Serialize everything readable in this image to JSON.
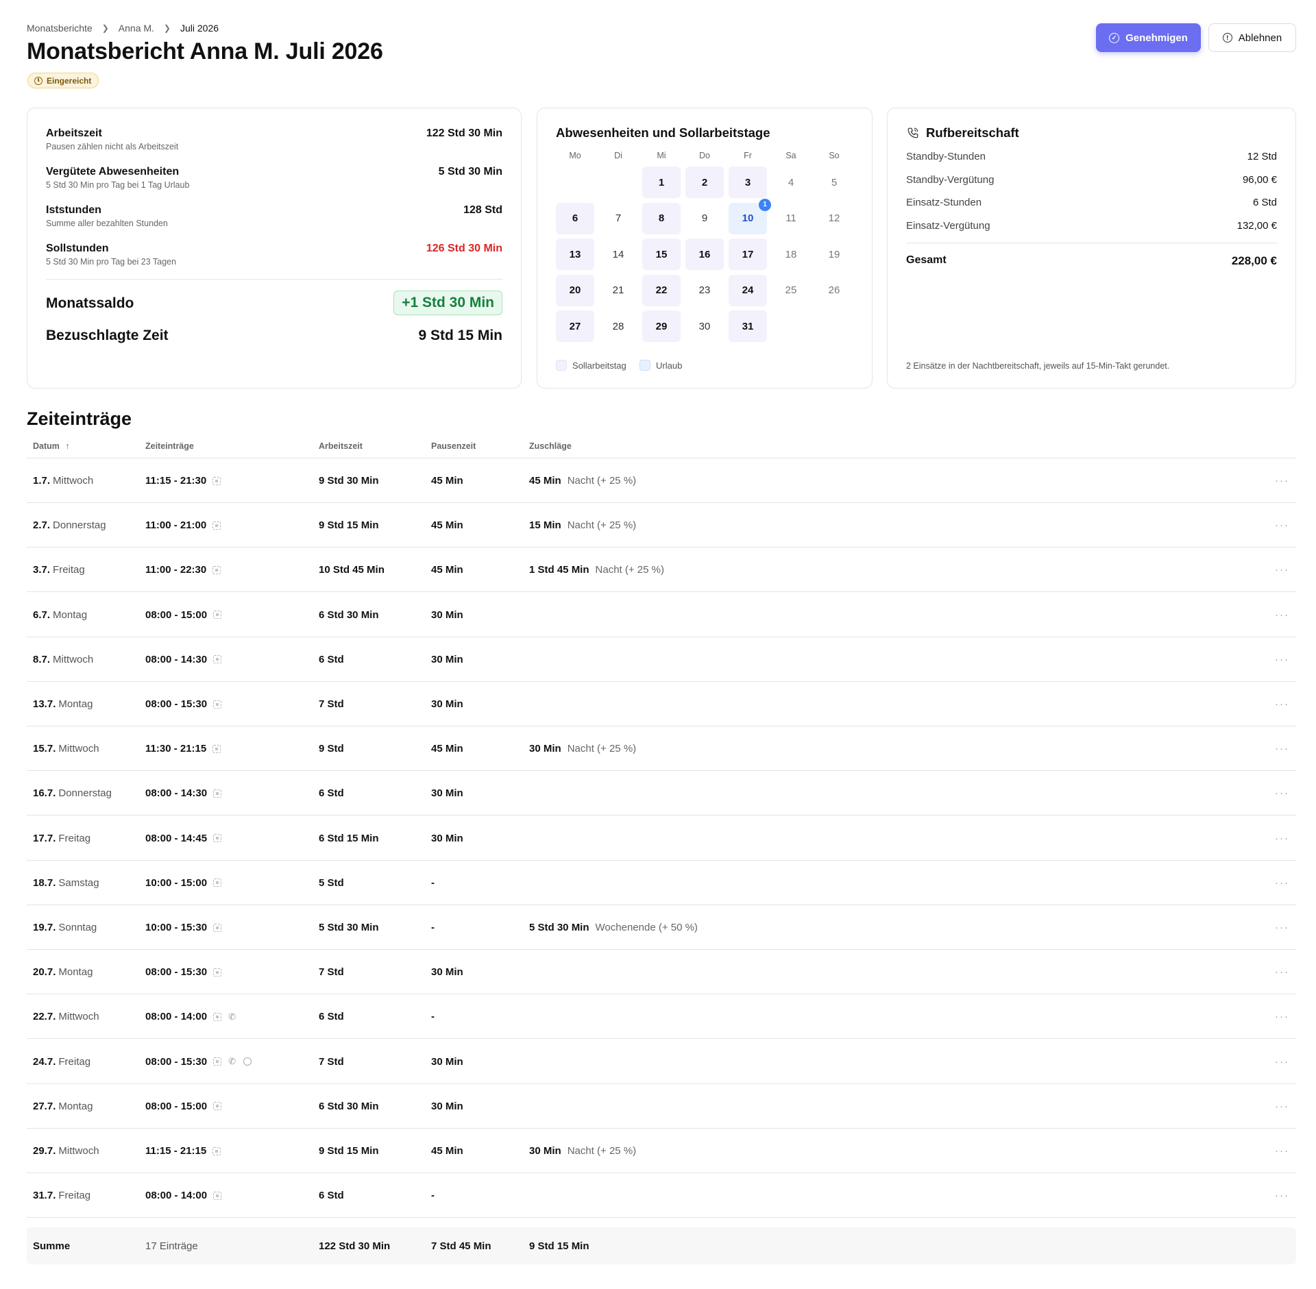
{
  "breadcrumb": [
    "Monatsberichte",
    "Anna M.",
    "Juli 2026"
  ],
  "page_title": "Monatsbericht Anna M. Juli 2026",
  "status": "Eingereicht",
  "actions": {
    "approve": "Genehmigen",
    "reject": "Ablehnen"
  },
  "colors": {
    "accent": "#6b6ef0",
    "negative": "#dc2626",
    "positive": "#15803d",
    "status_bg": "#fdf3dc"
  },
  "summary": {
    "arbeitszeit": {
      "label": "Arbeitszeit",
      "sub": "Pausen zählen nicht als Arbeitszeit",
      "value": "122 Std 30 Min"
    },
    "abwesenheiten": {
      "label": "Vergütete Abwesenheiten",
      "sub": "5 Std 30 Min pro Tag bei 1 Tag Urlaub",
      "value": "5 Std 30 Min"
    },
    "iststunden": {
      "label": "Iststunden",
      "sub": "Summe aller bezahlten Stunden",
      "value": "128 Std"
    },
    "sollstunden": {
      "label": "Sollstunden",
      "sub": "5 Std 30 Min pro Tag bei 23 Tagen",
      "value": "126 Std 30 Min"
    },
    "saldo": {
      "label": "Monatssaldo",
      "value": "+1 Std 30 Min"
    },
    "zuschlag": {
      "label": "Bezuschlagte Zeit",
      "value": "9 Std 15 Min"
    }
  },
  "calendar": {
    "title": "Abwesenheiten und Sollarbeitstage",
    "weekdays": [
      "Mo",
      "Di",
      "Mi",
      "Do",
      "Fr",
      "Sa",
      "So"
    ],
    "weeks": [
      [
        null,
        null,
        {
          "d": "1",
          "t": "w"
        },
        {
          "d": "2",
          "t": "w"
        },
        {
          "d": "3",
          "t": "w"
        },
        {
          "d": "4",
          "t": "wk"
        },
        {
          "d": "5",
          "t": "wk"
        }
      ],
      [
        {
          "d": "6",
          "t": "w"
        },
        {
          "d": "7",
          "t": "p"
        },
        {
          "d": "8",
          "t": "w"
        },
        {
          "d": "9",
          "t": "p"
        },
        {
          "d": "10",
          "t": "u",
          "badge": "1"
        },
        {
          "d": "11",
          "t": "wk"
        },
        {
          "d": "12",
          "t": "wk"
        }
      ],
      [
        {
          "d": "13",
          "t": "w"
        },
        {
          "d": "14",
          "t": "p"
        },
        {
          "d": "15",
          "t": "w"
        },
        {
          "d": "16",
          "t": "w"
        },
        {
          "d": "17",
          "t": "w"
        },
        {
          "d": "18",
          "t": "wk"
        },
        {
          "d": "19",
          "t": "wk"
        }
      ],
      [
        {
          "d": "20",
          "t": "w"
        },
        {
          "d": "21",
          "t": "p"
        },
        {
          "d": "22",
          "t": "w"
        },
        {
          "d": "23",
          "t": "p"
        },
        {
          "d": "24",
          "t": "w"
        },
        {
          "d": "25",
          "t": "wk"
        },
        {
          "d": "26",
          "t": "wk"
        }
      ],
      [
        {
          "d": "27",
          "t": "w"
        },
        {
          "d": "28",
          "t": "p"
        },
        {
          "d": "29",
          "t": "w"
        },
        {
          "d": "30",
          "t": "p"
        },
        {
          "d": "31",
          "t": "w"
        },
        null,
        null
      ]
    ],
    "legend": [
      "Sollarbeitstag",
      "Urlaub"
    ]
  },
  "standby": {
    "title": "Rufbereitschaft",
    "rows": [
      {
        "label": "Standby-Stunden",
        "value": "12 Std"
      },
      {
        "label": "Standby-Vergütung",
        "value": "96,00 €"
      },
      {
        "label": "Einsatz-Stunden",
        "value": "6 Std"
      },
      {
        "label": "Einsatz-Vergütung",
        "value": "132,00 €"
      }
    ],
    "total_label": "Gesamt",
    "total_value": "228,00 €",
    "note": "2 Einsätze in der Nachtbereitschaft, jeweils auf 15-Min-Takt gerundet."
  },
  "table": {
    "title": "Zeiteinträge",
    "columns": [
      "Datum",
      "Zeiteinträge",
      "Arbeitszeit",
      "Pausenzeit",
      "Zuschläge"
    ],
    "sort_indicator": "↑",
    "more_label": "···",
    "rows": [
      {
        "date": "1.7.",
        "day": "Mittwoch",
        "time": "11:15 - 21:30",
        "icons": [
          "qr"
        ],
        "work": "9 Std 30 Min",
        "pause": "45 Min",
        "sur": "45 Min",
        "sur_type": "Nacht (+ 25 %)"
      },
      {
        "date": "2.7.",
        "day": "Donnerstag",
        "time": "11:00 - 21:00",
        "icons": [
          "qr"
        ],
        "work": "9 Std 15 Min",
        "pause": "45 Min",
        "sur": "15 Min",
        "sur_type": "Nacht (+ 25 %)"
      },
      {
        "date": "3.7.",
        "day": "Freitag",
        "time": "11:00 - 22:30",
        "icons": [
          "qr"
        ],
        "work": "10 Std 45 Min",
        "pause": "45 Min",
        "sur": "1 Std 45 Min",
        "sur_type": "Nacht (+ 25 %)"
      },
      {
        "date": "6.7.",
        "day": "Montag",
        "time": "08:00 - 15:00",
        "icons": [
          "qr"
        ],
        "work": "6 Std 30 Min",
        "pause": "30 Min",
        "sur": "",
        "sur_type": ""
      },
      {
        "date": "8.7.",
        "day": "Mittwoch",
        "time": "08:00 - 14:30",
        "icons": [
          "qr"
        ],
        "work": "6 Std",
        "pause": "30 Min",
        "sur": "",
        "sur_type": ""
      },
      {
        "date": "13.7.",
        "day": "Montag",
        "time": "08:00 - 15:30",
        "icons": [
          "qr"
        ],
        "work": "7 Std",
        "pause": "30 Min",
        "sur": "",
        "sur_type": ""
      },
      {
        "date": "15.7.",
        "day": "Mittwoch",
        "time": "11:30 - 21:15",
        "icons": [
          "qr"
        ],
        "work": "9 Std",
        "pause": "45 Min",
        "sur": "30 Min",
        "sur_type": "Nacht (+ 25 %)"
      },
      {
        "date": "16.7.",
        "day": "Donnerstag",
        "time": "08:00 - 14:30",
        "icons": [
          "qr"
        ],
        "work": "6 Std",
        "pause": "30 Min",
        "sur": "",
        "sur_type": ""
      },
      {
        "date": "17.7.",
        "day": "Freitag",
        "time": "08:00 - 14:45",
        "icons": [
          "qr"
        ],
        "work": "6 Std 15 Min",
        "pause": "30 Min",
        "sur": "",
        "sur_type": ""
      },
      {
        "date": "18.7.",
        "day": "Samstag",
        "time": "10:00 - 15:00",
        "icons": [
          "qr"
        ],
        "work": "5 Std",
        "pause": "-",
        "sur": "",
        "sur_type": ""
      },
      {
        "date": "19.7.",
        "day": "Sonntag",
        "time": "10:00 - 15:30",
        "icons": [
          "qr"
        ],
        "work": "5 Std 30 Min",
        "pause": "-",
        "sur": "5 Std 30 Min",
        "sur_type": "Wochenende (+ 50 %)"
      },
      {
        "date": "20.7.",
        "day": "Montag",
        "time": "08:00 - 15:30",
        "icons": [
          "qr"
        ],
        "work": "7 Std",
        "pause": "30 Min",
        "sur": "",
        "sur_type": ""
      },
      {
        "date": "22.7.",
        "day": "Mittwoch",
        "time": "08:00 - 14:00",
        "icons": [
          "qr",
          "phone"
        ],
        "work": "6 Std",
        "pause": "-",
        "sur": "",
        "sur_type": ""
      },
      {
        "date": "24.7.",
        "day": "Freitag",
        "time": "08:00 - 15:30",
        "icons": [
          "qr",
          "phone",
          "clock"
        ],
        "work": "7 Std",
        "pause": "30 Min",
        "sur": "",
        "sur_type": ""
      },
      {
        "date": "27.7.",
        "day": "Montag",
        "time": "08:00 - 15:00",
        "icons": [
          "qr"
        ],
        "work": "6 Std 30 Min",
        "pause": "30 Min",
        "sur": "",
        "sur_type": ""
      },
      {
        "date": "29.7.",
        "day": "Mittwoch",
        "time": "11:15 - 21:15",
        "icons": [
          "qr"
        ],
        "work": "9 Std 15 Min",
        "pause": "45 Min",
        "sur": "30 Min",
        "sur_type": "Nacht (+ 25 %)"
      },
      {
        "date": "31.7.",
        "day": "Freitag",
        "time": "08:00 - 14:00",
        "icons": [
          "qr"
        ],
        "work": "6 Std",
        "pause": "-",
        "sur": "",
        "sur_type": ""
      }
    ],
    "sum": {
      "label": "Summe",
      "count": "17 Einträge",
      "work": "122 Std 30 Min",
      "pause": "7 Std 45 Min",
      "sur": "9 Std 15 Min"
    }
  }
}
